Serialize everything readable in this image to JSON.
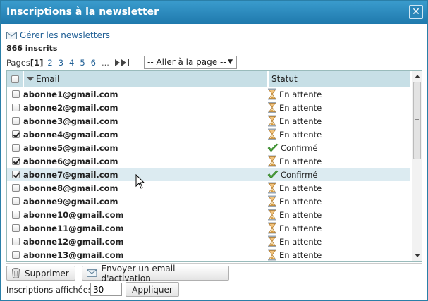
{
  "dialog": {
    "title": "Inscriptions à la newsletter",
    "close_label": "✕"
  },
  "header": {
    "manage_link": "Gérer les newsletters",
    "count": "866 inscrits"
  },
  "pager": {
    "label": "Pages",
    "current": "[1]",
    "pages": [
      "2",
      "3",
      "4",
      "5",
      "6"
    ],
    "ellipsis": "...",
    "goto_select": "-- Aller à la page --"
  },
  "table": {
    "columns": [
      "Email",
      "Statut"
    ],
    "rows": [
      {
        "email": "abonne1@gmail.com",
        "status": "En attente",
        "status_icon": "hourglass-icon",
        "checked": false
      },
      {
        "email": "abonne2@gmail.com",
        "status": "En attente",
        "status_icon": "hourglass-icon",
        "checked": false
      },
      {
        "email": "abonne3@gmail.com",
        "status": "En attente",
        "status_icon": "hourglass-icon",
        "checked": false
      },
      {
        "email": "abonne4@gmail.com",
        "status": "En attente",
        "status_icon": "hourglass-icon",
        "checked": true
      },
      {
        "email": "abonne5@gmail.com",
        "status": "Confirmé",
        "status_icon": "checkmark-icon",
        "checked": false
      },
      {
        "email": "abonne6@gmail.com",
        "status": "En attente",
        "status_icon": "hourglass-icon",
        "checked": true
      },
      {
        "email": "abonne7@gmail.com",
        "status": "Confirmé",
        "status_icon": "checkmark-icon",
        "checked": true,
        "highlighted": true
      },
      {
        "email": "abonne8@gmail.com",
        "status": "En attente",
        "status_icon": "hourglass-icon",
        "checked": false
      },
      {
        "email": "abonne9@gmail.com",
        "status": "En attente",
        "status_icon": "hourglass-icon",
        "checked": false
      },
      {
        "email": "abonne10@gmail.com",
        "status": "En attente",
        "status_icon": "hourglass-icon",
        "checked": false
      },
      {
        "email": "abonne11@gmail.com",
        "status": "En attente",
        "status_icon": "hourglass-icon",
        "checked": false
      },
      {
        "email": "abonne12@gmail.com",
        "status": "En attente",
        "status_icon": "hourglass-icon",
        "checked": false
      },
      {
        "email": "abonne13@gmail.com",
        "status": "En attente",
        "status_icon": "hourglass-icon",
        "checked": false
      }
    ]
  },
  "actions": {
    "delete_label": "Supprimer",
    "send_activation_label": "Envoyer un email d'activation"
  },
  "footer": {
    "shown_label": "Inscriptions affichées",
    "shown_value": "30",
    "apply_label": "Appliquer"
  },
  "colors": {
    "titlebar": "#2a86b9",
    "header_bg": "#c7dfe6",
    "highlight_row": "#dcebf1",
    "link": "#1f5f95"
  }
}
